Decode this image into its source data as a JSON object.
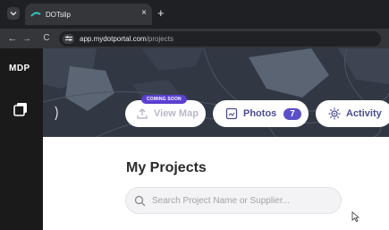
{
  "browser": {
    "tab_title": "DOTslip",
    "tab_close": "×",
    "new_tab": "+",
    "back": "←",
    "forward": "→",
    "reload": "C",
    "url_domain": "app.mydotportal.com",
    "url_path": "/projects"
  },
  "app": {
    "logo_text": "MDP",
    "hero": {
      "coming_soon": "COMING SOON",
      "view_map_label": "View Map",
      "photos_label": "Photos",
      "photos_count": "7",
      "activity_label": "Activity"
    },
    "page_title": "My Projects",
    "search": {
      "placeholder": "Search Project Name or Supplier..."
    }
  },
  "colors": {
    "accent": "#5b4fc9",
    "coming_soon_bg": "#5b3fd0",
    "sidebar_bg": "#1a1a1a",
    "hero_bg": "#2f3640"
  }
}
